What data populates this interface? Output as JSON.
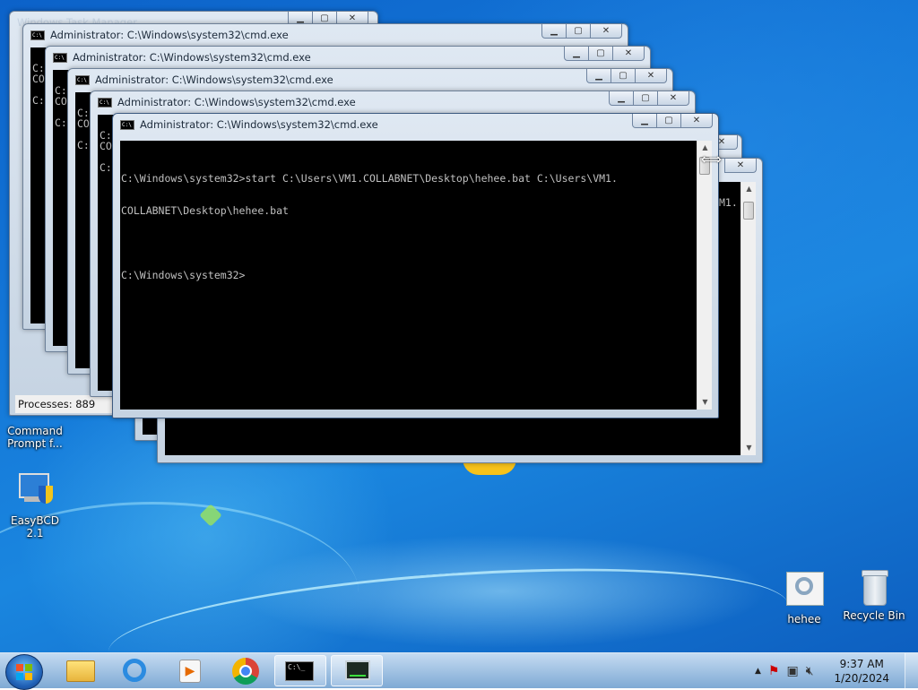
{
  "desktop": {
    "icons": [
      {
        "label": "Command Prompt f..."
      },
      {
        "label": "EasyBCD 2.1"
      },
      {
        "label": "hehee"
      },
      {
        "label": "Recycle Bin"
      }
    ]
  },
  "background_window": {
    "title": "Windows Task Manager",
    "status": "Processes: 889"
  },
  "cmd_windows": {
    "title": "Administrator: C:\\Windows\\system32\\cmd.exe",
    "prompt_fragment": "C:",
    "prompt_fragment2": "CO",
    "right_fragment": "M1."
  },
  "active_console": {
    "line1": "C:\\Windows\\system32>start C:\\Users\\VM1.COLLABNET\\Desktop\\hehee.bat C:\\Users\\VM1.",
    "line2": "COLLABNET\\Desktop\\hehee.bat",
    "line3": "C:\\Windows\\system32>"
  },
  "taskbar": {
    "time": "9:37 AM",
    "date": "1/20/2024"
  }
}
